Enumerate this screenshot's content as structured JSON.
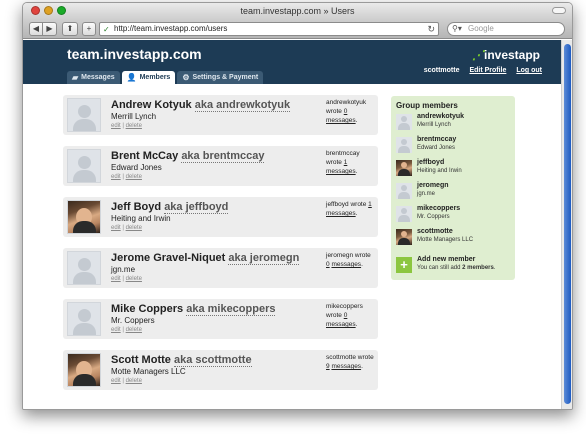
{
  "window": {
    "title": "team.investapp.com » Users"
  },
  "toolbar": {
    "url": "http://team.investapp.com/users",
    "search_placeholder": "Google"
  },
  "header": {
    "site_title": "team.investapp.com",
    "brand": "investapp",
    "username": "scottmotte",
    "edit_profile": "Edit Profile",
    "logout": "Log out",
    "tabs": [
      {
        "label": "Messages",
        "icon": "speech-bubble-icon",
        "active": false
      },
      {
        "label": "Members",
        "icon": "person-icon",
        "active": true
      },
      {
        "label": "Settings & Payment",
        "icon": "gear-icon",
        "active": false
      }
    ]
  },
  "members": [
    {
      "name": "Andrew Kotyuk",
      "aka": "aka andrewkotyuk",
      "company": "Merrill Lynch",
      "edit": "edit",
      "delete": "delete",
      "wrote_prefix": "andrewkotyuk wrote",
      "count": "0",
      "messages": "messages",
      "photo": false
    },
    {
      "name": "Brent McCay",
      "aka": "aka brentmccay",
      "company": "Edward Jones",
      "edit": "edit",
      "delete": "delete",
      "wrote_prefix": "brentmccay wrote",
      "count": "1",
      "messages": "messages",
      "photo": false
    },
    {
      "name": "Jeff Boyd",
      "aka": "aka jeffboyd",
      "company": "Heiting and Irwin",
      "edit": "edit",
      "delete": "delete",
      "wrote_prefix": "jeffboyd wrote",
      "count": "1",
      "messages": "messages",
      "photo": true
    },
    {
      "name": "Jerome Gravel-Niquet",
      "aka": "aka jeromegn",
      "company": "jgn.me",
      "edit": "edit",
      "delete": "delete",
      "wrote_prefix": "jeromegn wrote",
      "count": "0",
      "messages": "messages",
      "photo": false
    },
    {
      "name": "Mike Coppers",
      "aka": "aka mikecoppers",
      "company": "Mr. Coppers",
      "edit": "edit",
      "delete": "delete",
      "wrote_prefix": "mikecoppers wrote",
      "count": "0",
      "messages": "messages",
      "photo": false
    },
    {
      "name": "Scott Motte",
      "aka": "aka scottmotte",
      "company": "Motte Managers LLC",
      "edit": "edit",
      "delete": "delete",
      "wrote_prefix": "scottmotte wrote",
      "count": "9",
      "messages": "messages",
      "photo": true
    }
  ],
  "sidebar": {
    "title": "Group members",
    "items": [
      {
        "username": "andrewkotyuk",
        "company": "Merrill Lynch",
        "photo": false
      },
      {
        "username": "brentmccay",
        "company": "Edward Jones",
        "photo": false
      },
      {
        "username": "jeffboyd",
        "company": "Heiting and Irwin",
        "photo": true
      },
      {
        "username": "jeromegn",
        "company": "jgn.me",
        "photo": false
      },
      {
        "username": "mikecoppers",
        "company": "Mr. Coppers",
        "photo": false
      },
      {
        "username": "scottmotte",
        "company": "Motte Managers LLC",
        "photo": true
      }
    ],
    "add_label": "Add new member",
    "add_note_prefix": "You can still add",
    "add_note_count": "2 members",
    "add_note_suffix": "."
  },
  "colors": {
    "header_bg": "#1d3b55",
    "sidebar_bg": "#dfeed0",
    "accent_green": "#8cc63f",
    "card_bg": "#ededed"
  }
}
